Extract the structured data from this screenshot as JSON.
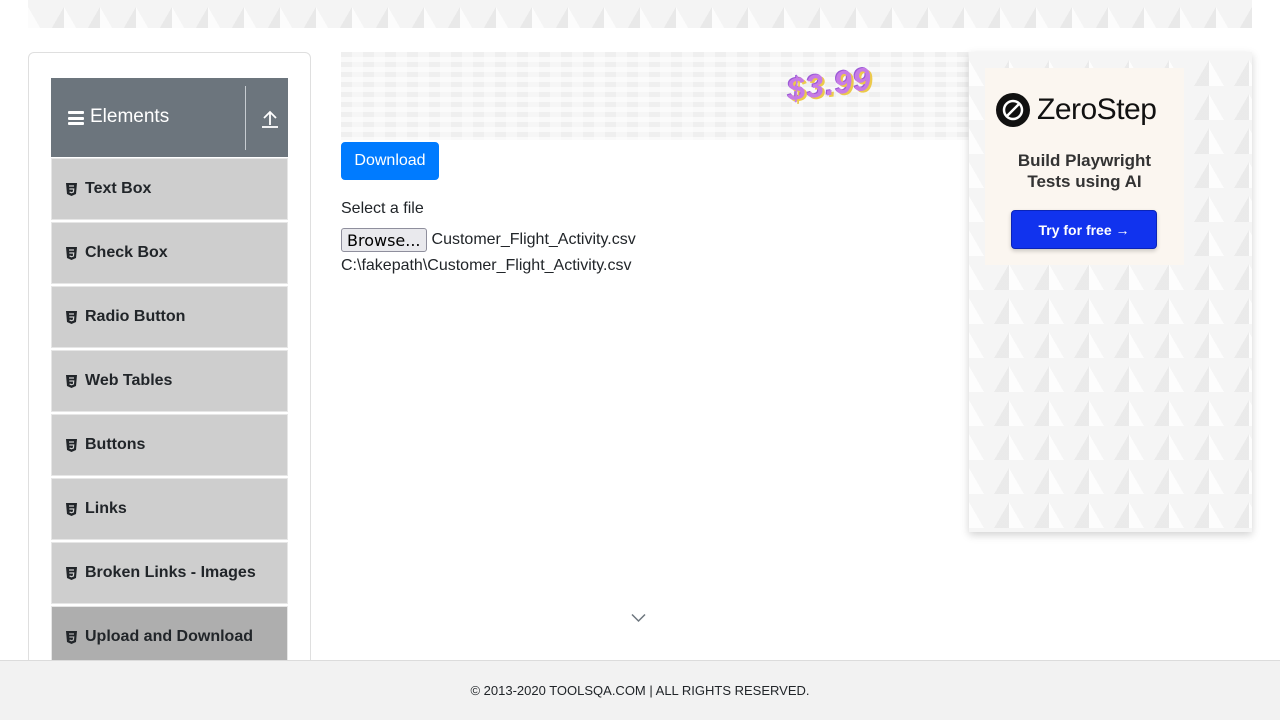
{
  "sidebar": {
    "group_title": "Elements",
    "items": [
      {
        "label": "Text Box"
      },
      {
        "label": "Check Box"
      },
      {
        "label": "Radio Button"
      },
      {
        "label": "Web Tables"
      },
      {
        "label": "Buttons"
      },
      {
        "label": "Links"
      },
      {
        "label": "Broken Links - Images"
      },
      {
        "label": "Upload and Download",
        "active": true
      }
    ]
  },
  "banner_ad": {
    "price": "$3.99"
  },
  "main": {
    "download_label": "Download",
    "select_file_label": "Select a file",
    "browse_label": "Browse...",
    "selected_file_name": "Customer_Flight_Activity.csv",
    "uploaded_file_path": "C:\\fakepath\\Customer_Flight_Activity.csv"
  },
  "side_ad": {
    "brand": "ZeroStep",
    "tagline": "Build Playwright Tests using AI",
    "cta": "Try for free →"
  },
  "footer": {
    "copyright": "© 2013-2020 TOOLSQA.COM | ALL RIGHTS RESERVED."
  },
  "colors": {
    "primary": "#007bff",
    "group_header_bg": "#6c757d",
    "menu_item_bg": "#cecece",
    "menu_item_active_bg": "#aeaeae",
    "ad_cta_bg": "#1133ee"
  },
  "icons": {
    "group_menu": "hamburger-icon",
    "group_collapse": "upload-arrow-icon",
    "menu_item": "html5-shield-icon",
    "scroll": "chevron-down-icon",
    "brand_logo": "zerostep-logo-icon"
  }
}
